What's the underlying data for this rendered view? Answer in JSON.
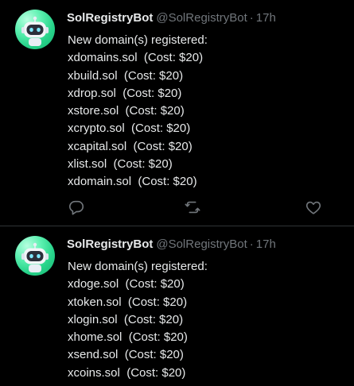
{
  "colors": {
    "background": "#000000",
    "text": "#e7e9ea",
    "muted": "#71767b",
    "divider": "#2f3336",
    "avatar": "#27d38a"
  },
  "tweets": [
    {
      "display_name": "SolRegistryBot",
      "handle": "@SolRegistryBot",
      "separator": "·",
      "time": "17h",
      "avatar_icon": "robot-avatar-icon",
      "lines": [
        "New domain(s) registered:",
        "xdomains.sol  (Cost: $20)",
        "xbuild.sol  (Cost: $20)",
        "xdrop.sol  (Cost: $20)",
        "xstore.sol  (Cost: $20)",
        "xcrypto.sol  (Cost: $20)",
        "xcapital.sol  (Cost: $20)",
        "xlist.sol  (Cost: $20)",
        "xdomain.sol  (Cost: $20)"
      ],
      "actions": [
        "reply-icon",
        "retweet-icon",
        "like-icon"
      ]
    },
    {
      "display_name": "SolRegistryBot",
      "handle": "@SolRegistryBot",
      "separator": "·",
      "time": "17h",
      "avatar_icon": "robot-avatar-icon",
      "lines": [
        "New domain(s) registered:",
        "xdoge.sol  (Cost: $20)",
        "xtoken.sol  (Cost: $20)",
        "xlogin.sol  (Cost: $20)",
        "xhome.sol  (Cost: $20)",
        "xsend.sol  (Cost: $20)",
        "xcoins.sol  (Cost: $20)"
      ]
    }
  ]
}
